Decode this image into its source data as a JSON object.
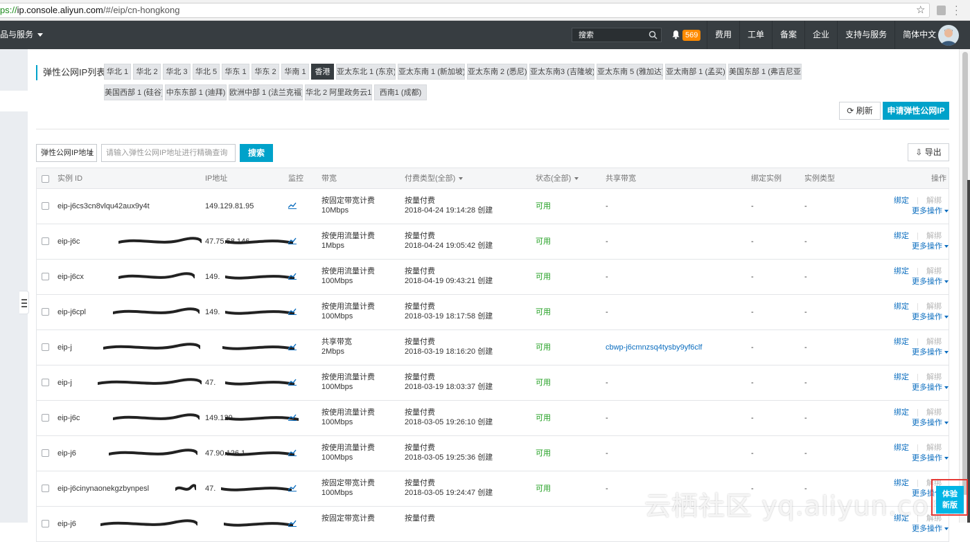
{
  "browser": {
    "url_prefix": "ps://",
    "url_host": "ip.console.aliyun.com",
    "url_path": "/#/eip/cn-hongkong"
  },
  "topnav": {
    "products": "品与服务",
    "search_placeholder": "搜索",
    "notifications_count": "569",
    "items": [
      "费用",
      "工单",
      "备案",
      "企业",
      "支持与服务",
      "简体中文"
    ]
  },
  "regions": {
    "title": "弹性公网IP列表",
    "row1": [
      "华北 1",
      "华北 2",
      "华北 3",
      "华北 5",
      "华东 1",
      "华东 2",
      "华南 1",
      "香港",
      "亚太东北 1 (东京)",
      "亚太东南 1 (新加坡)",
      "亚太东南 2 (悉尼)",
      "亚太东南3 (吉隆坡)",
      "亚太东南 5 (雅加达)",
      "亚太南部 1 (孟买)",
      "美国东部 1 (弗吉尼亚)"
    ],
    "row2": [
      "美国西部 1 (硅谷)",
      "中东东部 1 (迪拜)",
      "欧洲中部 1 (法兰克福)",
      "华北 2 阿里政务云1",
      "西南1 (成都)"
    ],
    "active": "香港"
  },
  "actions": {
    "refresh": "刷新",
    "apply": "申请弹性公网IP",
    "export": "导出"
  },
  "filter": {
    "field": "弹性公网IP地址",
    "placeholder": "请输入弹性公网IP地址进行精确查询",
    "search": "搜索"
  },
  "table": {
    "headers": {
      "id": "实例 ID",
      "ip": "IP地址",
      "monitor": "监控",
      "bandwidth": "带宽",
      "pay": "付费类型(全部)",
      "status": "状态(全部)",
      "shared": "共享带宽",
      "bound": "绑定实例",
      "type": "实例类型",
      "ops": "操作"
    },
    "op_bind": "绑定",
    "op_unbind": "解绑",
    "op_more": "更多操作",
    "rows": [
      {
        "id": "eip-j6cs3cn8vlqu42aux9y4t",
        "ip": "149.129.81.95",
        "bw_type": "按固定带宽计费",
        "bw": "10Mbps",
        "pay": "按量付费",
        "created": "2018-04-24 19:14:28 创建",
        "status": "可用",
        "shared": "-",
        "bound": "-",
        "itype": "-"
      },
      {
        "id": "eip-j6c",
        "ip": "47.75.58.146",
        "bw_type": "按使用流量计费",
        "bw": "1Mbps",
        "pay": "按量付费",
        "created": "2018-04-24 19:05:42 创建",
        "status": "可用",
        "shared": "-",
        "bound": "-",
        "itype": "-"
      },
      {
        "id": "eip-j6cx",
        "ip": "149.",
        "bw_type": "按使用流量计费",
        "bw": "100Mbps",
        "pay": "按量付费",
        "created": "2018-04-19 09:43:21 创建",
        "status": "可用",
        "shared": "-",
        "bound": "-",
        "itype": "-"
      },
      {
        "id": "eip-j6cpl",
        "ip": "149.",
        "bw_type": "按使用流量计费",
        "bw": "100Mbps",
        "pay": "按量付费",
        "created": "2018-03-19 18:17:58 创建",
        "status": "可用",
        "shared": "-",
        "bound": "-",
        "itype": "-"
      },
      {
        "id": "eip-j",
        "ip": "",
        "bw_type": "共享带宽",
        "bw": "2Mbps",
        "pay": "按量付费",
        "created": "2018-03-19 18:16:20 创建",
        "status": "可用",
        "shared": "cbwp-j6cmnzsq4tysby9yf6clf",
        "bound": "-",
        "itype": "-"
      },
      {
        "id": "eip-j",
        "ip": "47.",
        "bw_type": "按使用流量计费",
        "bw": "100Mbps",
        "pay": "按量付费",
        "created": "2018-03-19 18:03:37 创建",
        "status": "可用",
        "shared": "-",
        "bound": "-",
        "itype": "-"
      },
      {
        "id": "eip-j6c",
        "ip": "149.129.",
        "bw_type": "按使用流量计费",
        "bw": "100Mbps",
        "pay": "按量付费",
        "created": "2018-03-05 19:26:10 创建",
        "status": "可用",
        "shared": "-",
        "bound": "-",
        "itype": "-"
      },
      {
        "id": "eip-j6",
        "ip": "47.90.126.1",
        "bw_type": "按使用流量计费",
        "bw": "100Mbps",
        "pay": "按量付费",
        "created": "2018-03-05 19:25:36 创建",
        "status": "可用",
        "shared": "-",
        "bound": "-",
        "itype": "-"
      },
      {
        "id": "eip-j6cinynaonekgzbynpesl",
        "ip": "47.",
        "bw_type": "按固定带宽计费",
        "bw": "100Mbps",
        "pay": "按量付费",
        "created": "2018-03-05 19:24:47 创建",
        "status": "可用",
        "shared": "-",
        "bound": "-",
        "itype": "-"
      },
      {
        "id": "eip-j6",
        "ip": "",
        "bw_type": "按固定带宽计费",
        "bw": "",
        "pay": "按量付费",
        "created": "",
        "status": "",
        "shared": "",
        "bound": "",
        "itype": ""
      }
    ]
  },
  "watermark": "云栖社区 yq.aliyun.com",
  "feedback": {
    "line1": "体验",
    "line2": "新版"
  },
  "colors": {
    "accent": "#00a2ca",
    "nav_bg": "#373d41",
    "status_green": "#1e9e1e",
    "link": "#0a6dbf",
    "badge": "#ff8a00"
  }
}
